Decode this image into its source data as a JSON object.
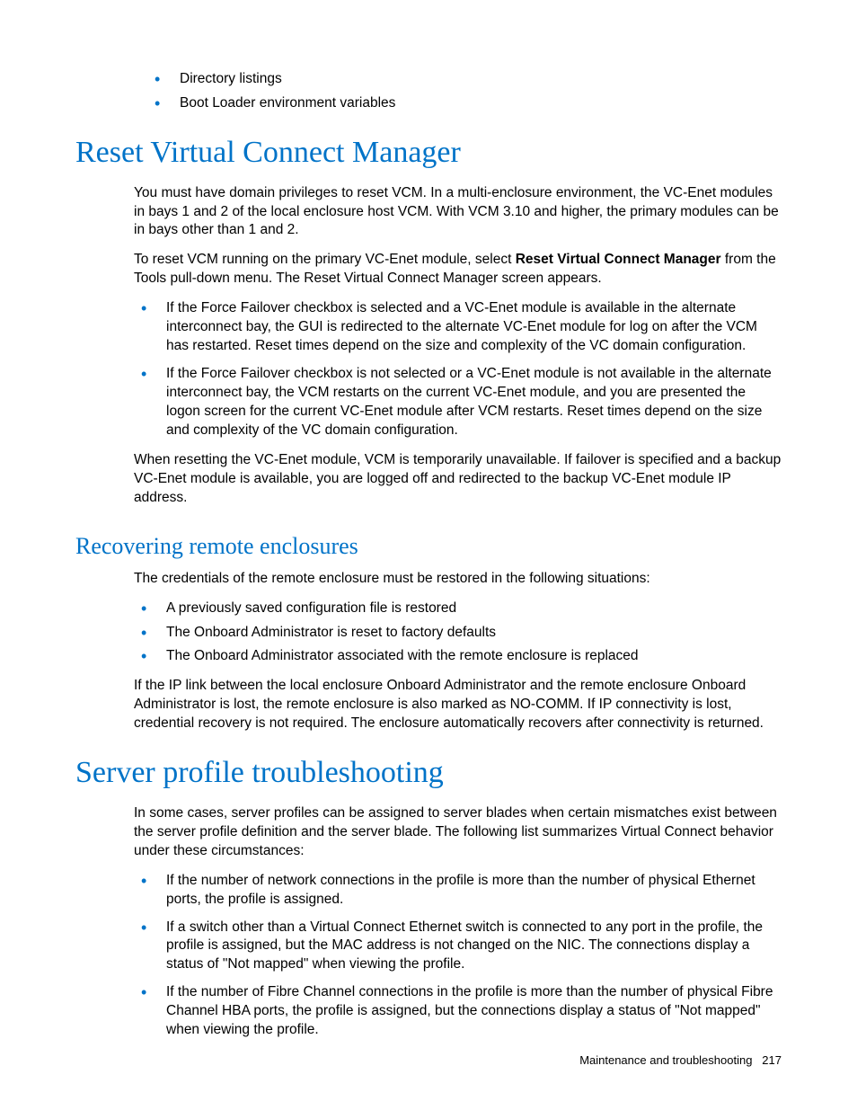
{
  "topList": {
    "items": [
      "Directory listings",
      "Boot Loader environment variables"
    ]
  },
  "section1": {
    "heading": "Reset Virtual Connect Manager",
    "p1": "You must have domain privileges to reset VCM. In a multi-enclosure environment, the VC-Enet modules in bays 1 and 2 of the local enclosure host VCM. With VCM 3.10 and higher, the primary modules can be in bays other than 1 and 2.",
    "p2a": "To reset VCM running on the primary VC-Enet module, select ",
    "p2b_bold": "Reset Virtual Connect Manager",
    "p2c": " from the Tools pull-down menu. The Reset Virtual Connect Manager screen appears.",
    "bullets": [
      "If the Force Failover checkbox is selected and a VC-Enet module is available in the alternate interconnect bay, the GUI is redirected to the alternate VC-Enet module for log on after the VCM has restarted. Reset times depend on the size and complexity of the VC domain configuration.",
      "If the Force Failover checkbox is not selected or a VC-Enet module is not available in the alternate interconnect bay, the VCM restarts on the current VC-Enet module, and you are presented the logon screen for the current VC-Enet module after VCM restarts. Reset times depend on the size and complexity of the VC domain configuration."
    ],
    "p3": "When resetting the VC-Enet module, VCM is temporarily unavailable. If failover is specified and a backup VC-Enet module is available, you are logged off and redirected to the backup VC-Enet module IP address."
  },
  "section2": {
    "heading": "Recovering remote enclosures",
    "p1": "The credentials of the remote enclosure must be restored in the following situations:",
    "bullets": [
      "A previously saved configuration file is restored",
      "The Onboard Administrator is reset to factory defaults",
      "The Onboard Administrator associated with the remote enclosure is replaced"
    ],
    "p2": "If the IP link between the local enclosure Onboard Administrator and the remote enclosure Onboard Administrator is lost, the remote enclosure is also marked as NO-COMM. If IP connectivity is lost, credential recovery is not required. The enclosure automatically recovers after connectivity is returned."
  },
  "section3": {
    "heading": "Server profile troubleshooting",
    "p1": "In some cases, server profiles can be assigned to server blades when certain mismatches exist between the server profile definition and the server blade. The following list summarizes Virtual Connect behavior under these circumstances:",
    "bullets": [
      "If the number of network connections in the profile is more than the number of physical Ethernet ports, the profile is assigned.",
      "If a switch other than a Virtual Connect Ethernet switch is connected to any port in the profile, the profile is assigned, but the MAC address is not changed on the NIC. The connections display a status of \"Not mapped\" when viewing the profile.",
      "If the number of Fibre Channel connections in the profile is more than the number of physical Fibre Channel HBA ports, the profile is assigned, but the connections display a status of \"Not mapped\" when viewing the profile."
    ]
  },
  "footer": {
    "section_label": "Maintenance and troubleshooting",
    "page_number": "217"
  }
}
